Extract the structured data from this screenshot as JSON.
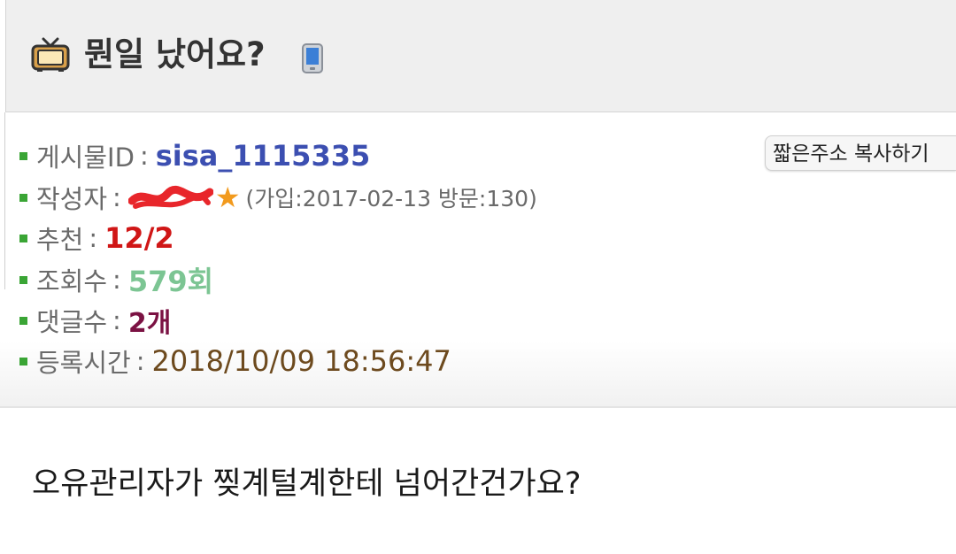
{
  "header": {
    "title": "뭔일 났어요?",
    "tv_icon": "tv-icon",
    "mobile_icon": "mobile-phone-icon"
  },
  "info": {
    "post_id": {
      "label": "게시물ID",
      "separator": ":",
      "value": "sisa_1115335"
    },
    "author": {
      "label": "작성자",
      "separator": ":",
      "star": "★",
      "join_info": "(가입:2017-02-13 방문:130)"
    },
    "recommend": {
      "label": "추천",
      "separator": ":",
      "value": "12/2"
    },
    "views": {
      "label": "조회수",
      "separator": ":",
      "value": "579회"
    },
    "comments": {
      "label": "댓글수",
      "separator": ":",
      "value": "2개"
    },
    "registered": {
      "label": "등록시간",
      "separator": ":",
      "value": "2018/10/09 18:56:47"
    },
    "copy_short_url_label": "짧은주소 복사하기"
  },
  "post": {
    "body": "오유관리자가 찢계털계한테 넘어간건가요?"
  },
  "colors": {
    "bullet": "#3aa535",
    "post_id": "#3c4fb1",
    "recommend": "#d01616",
    "views": "#7cc593",
    "comments": "#7b1243",
    "registered": "#6d4a1e",
    "star": "#f29a1d",
    "redaction": "#e8262b"
  }
}
